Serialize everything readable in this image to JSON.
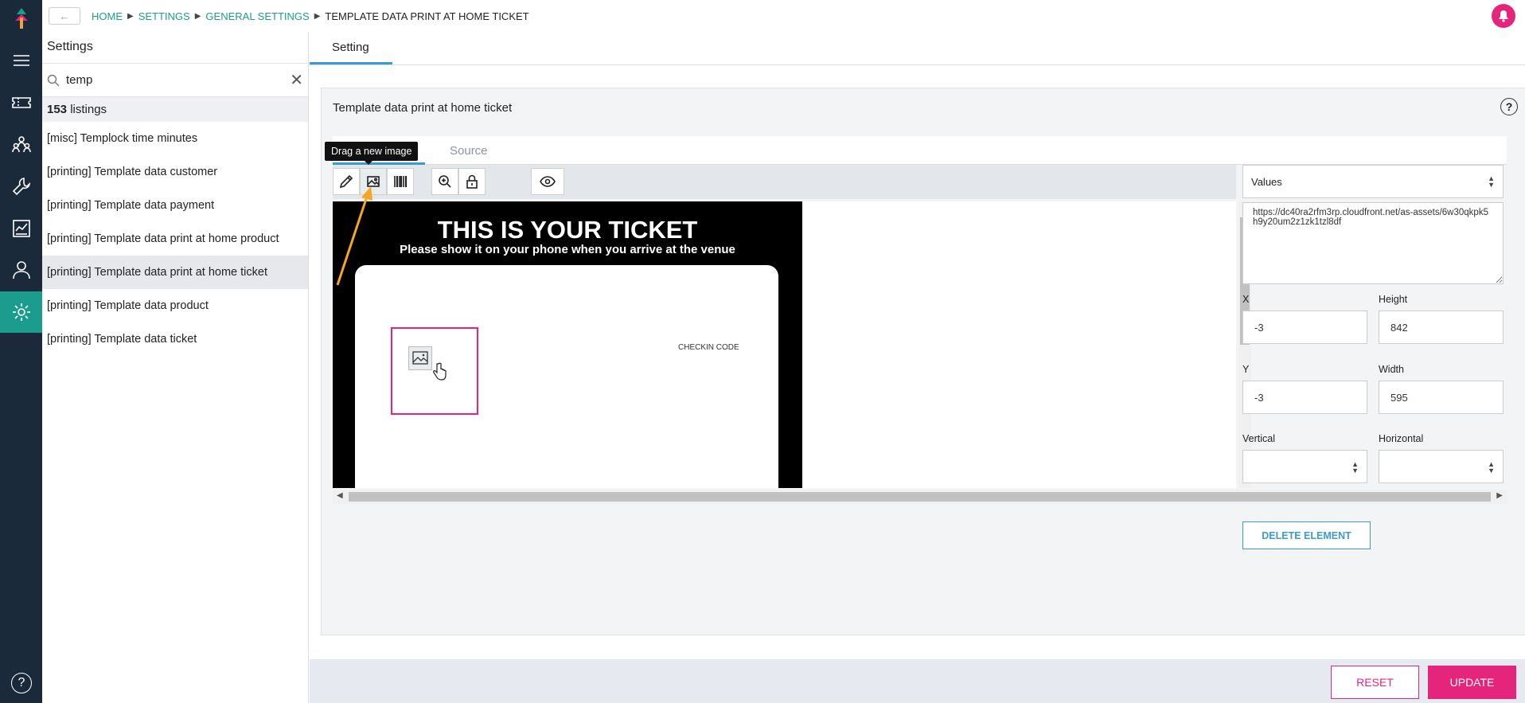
{
  "colors": {
    "rail": "#1b2a3a",
    "accent": "#1c9c8c",
    "brand_pink": "#e5247b",
    "blue": "#3b9bd0"
  },
  "rail": {
    "icons": [
      "logo-icon",
      "menu-icon",
      "ticket-icon",
      "users-group-icon",
      "wrench-icon",
      "report-icon",
      "person-icon",
      "gear-icon",
      "help-icon"
    ],
    "help_label": "?"
  },
  "topbar": {
    "back_label": "←",
    "breadcrumbs": [
      "HOME",
      "SETTINGS",
      "GENERAL SETTINGS",
      "TEMPLATE DATA PRINT AT HOME TICKET"
    ]
  },
  "sidebar": {
    "title": "Settings",
    "search_value": "temp",
    "count_number": "153",
    "count_suffix": " listings",
    "items": [
      "[misc] Templock time minutes",
      "[printing] Template data customer",
      "[printing] Template data payment",
      "[printing] Template data print at home product",
      "[printing] Template data print at home ticket",
      "[printing] Template data product",
      "[printing] Template data ticket"
    ],
    "selected_index": 4
  },
  "main": {
    "tab_label": "Setting",
    "card_title": "Template data print at home ticket",
    "help_label": "?",
    "subtab_source": "Source",
    "tooltip": "Drag a new image",
    "ticket": {
      "title": "THIS IS YOUR TICKET",
      "subtitle": "Please show it on your phone when you arrive at the venue",
      "checkin": "CHECKIN CODE"
    },
    "values_select": "Values",
    "url_value": "https://dc40ra2rfm3rp.cloudfront.net/as-assets/6w30qkpk5h9y20um2z1zk1tzl8df",
    "fields": {
      "x_label": "X",
      "x_value": "-3",
      "height_label": "Height",
      "height_value": "842",
      "y_label": "Y",
      "y_value": "-3",
      "width_label": "Width",
      "width_value": "595",
      "vertical_label": "Vertical",
      "horizontal_label": "Horizontal"
    },
    "delete_label": "DELETE ELEMENT"
  },
  "footer": {
    "reset_label": "RESET",
    "update_label": "UPDATE"
  }
}
